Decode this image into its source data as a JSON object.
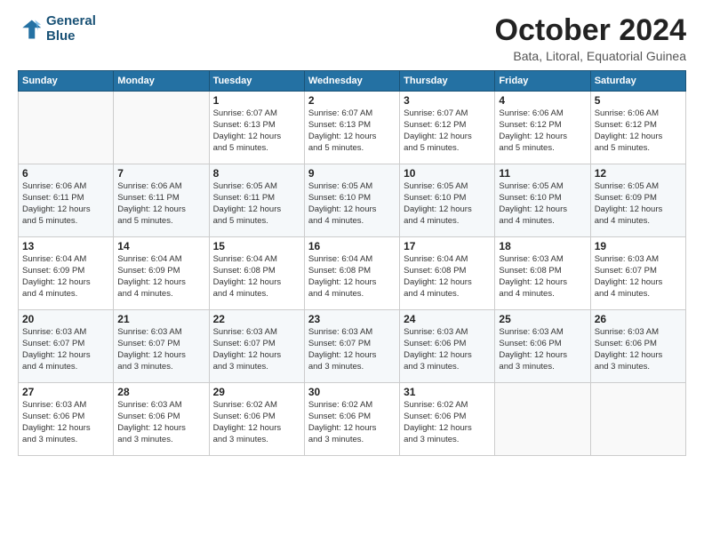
{
  "header": {
    "logo_line1": "General",
    "logo_line2": "Blue",
    "month_title": "October 2024",
    "subtitle": "Bata, Litoral, Equatorial Guinea"
  },
  "weekdays": [
    "Sunday",
    "Monday",
    "Tuesday",
    "Wednesday",
    "Thursday",
    "Friday",
    "Saturday"
  ],
  "weeks": [
    [
      {
        "day": "",
        "info": ""
      },
      {
        "day": "",
        "info": ""
      },
      {
        "day": "1",
        "info": "Sunrise: 6:07 AM\nSunset: 6:13 PM\nDaylight: 12 hours\nand 5 minutes."
      },
      {
        "day": "2",
        "info": "Sunrise: 6:07 AM\nSunset: 6:13 PM\nDaylight: 12 hours\nand 5 minutes."
      },
      {
        "day": "3",
        "info": "Sunrise: 6:07 AM\nSunset: 6:12 PM\nDaylight: 12 hours\nand 5 minutes."
      },
      {
        "day": "4",
        "info": "Sunrise: 6:06 AM\nSunset: 6:12 PM\nDaylight: 12 hours\nand 5 minutes."
      },
      {
        "day": "5",
        "info": "Sunrise: 6:06 AM\nSunset: 6:12 PM\nDaylight: 12 hours\nand 5 minutes."
      }
    ],
    [
      {
        "day": "6",
        "info": "Sunrise: 6:06 AM\nSunset: 6:11 PM\nDaylight: 12 hours\nand 5 minutes."
      },
      {
        "day": "7",
        "info": "Sunrise: 6:06 AM\nSunset: 6:11 PM\nDaylight: 12 hours\nand 5 minutes."
      },
      {
        "day": "8",
        "info": "Sunrise: 6:05 AM\nSunset: 6:11 PM\nDaylight: 12 hours\nand 5 minutes."
      },
      {
        "day": "9",
        "info": "Sunrise: 6:05 AM\nSunset: 6:10 PM\nDaylight: 12 hours\nand 4 minutes."
      },
      {
        "day": "10",
        "info": "Sunrise: 6:05 AM\nSunset: 6:10 PM\nDaylight: 12 hours\nand 4 minutes."
      },
      {
        "day": "11",
        "info": "Sunrise: 6:05 AM\nSunset: 6:10 PM\nDaylight: 12 hours\nand 4 minutes."
      },
      {
        "day": "12",
        "info": "Sunrise: 6:05 AM\nSunset: 6:09 PM\nDaylight: 12 hours\nand 4 minutes."
      }
    ],
    [
      {
        "day": "13",
        "info": "Sunrise: 6:04 AM\nSunset: 6:09 PM\nDaylight: 12 hours\nand 4 minutes."
      },
      {
        "day": "14",
        "info": "Sunrise: 6:04 AM\nSunset: 6:09 PM\nDaylight: 12 hours\nand 4 minutes."
      },
      {
        "day": "15",
        "info": "Sunrise: 6:04 AM\nSunset: 6:08 PM\nDaylight: 12 hours\nand 4 minutes."
      },
      {
        "day": "16",
        "info": "Sunrise: 6:04 AM\nSunset: 6:08 PM\nDaylight: 12 hours\nand 4 minutes."
      },
      {
        "day": "17",
        "info": "Sunrise: 6:04 AM\nSunset: 6:08 PM\nDaylight: 12 hours\nand 4 minutes."
      },
      {
        "day": "18",
        "info": "Sunrise: 6:03 AM\nSunset: 6:08 PM\nDaylight: 12 hours\nand 4 minutes."
      },
      {
        "day": "19",
        "info": "Sunrise: 6:03 AM\nSunset: 6:07 PM\nDaylight: 12 hours\nand 4 minutes."
      }
    ],
    [
      {
        "day": "20",
        "info": "Sunrise: 6:03 AM\nSunset: 6:07 PM\nDaylight: 12 hours\nand 4 minutes."
      },
      {
        "day": "21",
        "info": "Sunrise: 6:03 AM\nSunset: 6:07 PM\nDaylight: 12 hours\nand 3 minutes."
      },
      {
        "day": "22",
        "info": "Sunrise: 6:03 AM\nSunset: 6:07 PM\nDaylight: 12 hours\nand 3 minutes."
      },
      {
        "day": "23",
        "info": "Sunrise: 6:03 AM\nSunset: 6:07 PM\nDaylight: 12 hours\nand 3 minutes."
      },
      {
        "day": "24",
        "info": "Sunrise: 6:03 AM\nSunset: 6:06 PM\nDaylight: 12 hours\nand 3 minutes."
      },
      {
        "day": "25",
        "info": "Sunrise: 6:03 AM\nSunset: 6:06 PM\nDaylight: 12 hours\nand 3 minutes."
      },
      {
        "day": "26",
        "info": "Sunrise: 6:03 AM\nSunset: 6:06 PM\nDaylight: 12 hours\nand 3 minutes."
      }
    ],
    [
      {
        "day": "27",
        "info": "Sunrise: 6:03 AM\nSunset: 6:06 PM\nDaylight: 12 hours\nand 3 minutes."
      },
      {
        "day": "28",
        "info": "Sunrise: 6:03 AM\nSunset: 6:06 PM\nDaylight: 12 hours\nand 3 minutes."
      },
      {
        "day": "29",
        "info": "Sunrise: 6:02 AM\nSunset: 6:06 PM\nDaylight: 12 hours\nand 3 minutes."
      },
      {
        "day": "30",
        "info": "Sunrise: 6:02 AM\nSunset: 6:06 PM\nDaylight: 12 hours\nand 3 minutes."
      },
      {
        "day": "31",
        "info": "Sunrise: 6:02 AM\nSunset: 6:06 PM\nDaylight: 12 hours\nand 3 minutes."
      },
      {
        "day": "",
        "info": ""
      },
      {
        "day": "",
        "info": ""
      }
    ]
  ]
}
